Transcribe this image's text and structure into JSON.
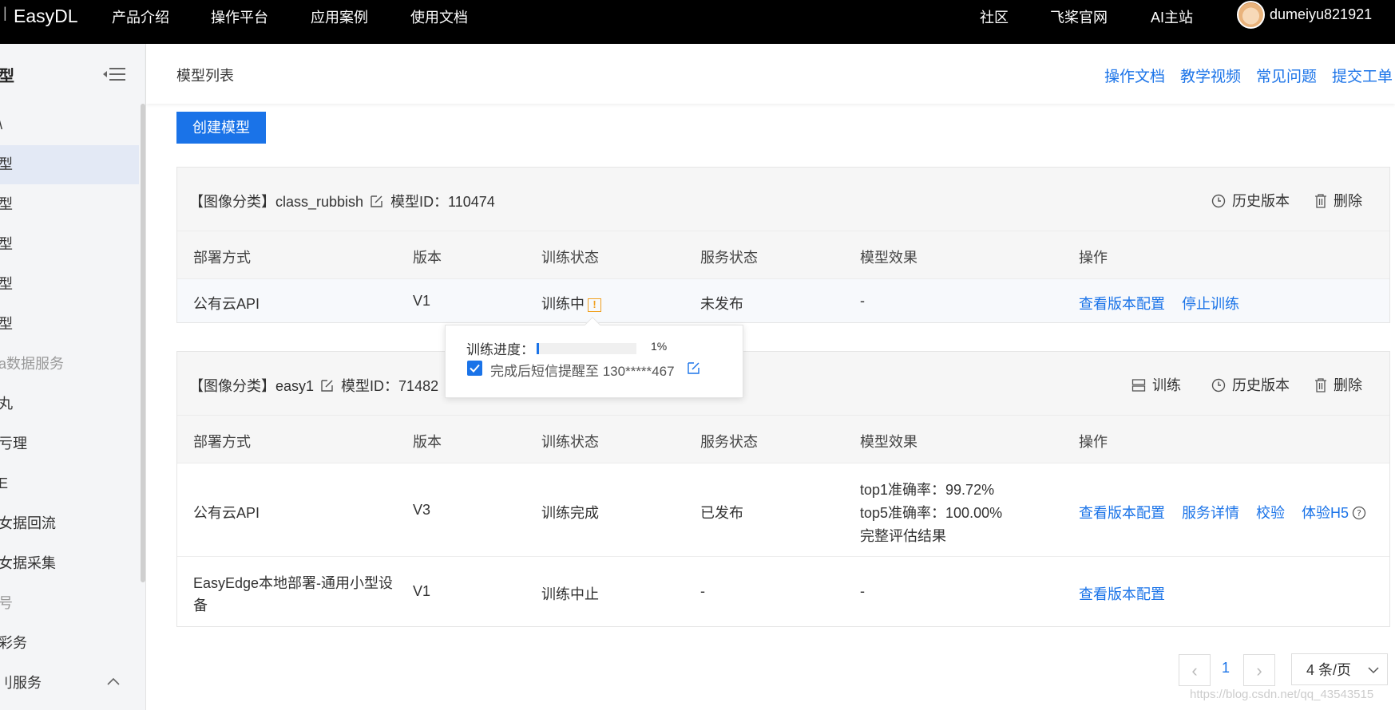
{
  "topbar": {
    "logo": "EasyDL",
    "nav": [
      "产品介绍",
      "操作平台",
      "应用案例",
      "使用文档"
    ],
    "right_nav": [
      "社区",
      "飞桨官网",
      "AI主站"
    ],
    "username": "dumeiyu821921"
  },
  "sidebar": {
    "title": "型",
    "items": [
      {
        "label": "\\",
        "active": false,
        "grey": false
      },
      {
        "label": "型",
        "active": true,
        "grey": false
      },
      {
        "label": "型",
        "active": false,
        "grey": false
      },
      {
        "label": "型",
        "active": false,
        "grey": false
      },
      {
        "label": "型",
        "active": false,
        "grey": false
      },
      {
        "label": "型",
        "active": false,
        "grey": false
      },
      {
        "label": "a数据服务",
        "active": false,
        "grey": true
      },
      {
        "label": "丸",
        "active": false,
        "grey": false
      },
      {
        "label": "亏理",
        "active": false,
        "grey": false
      },
      {
        "label": "E",
        "active": false,
        "grey": false
      },
      {
        "label": "女据回流",
        "active": false,
        "grey": false
      },
      {
        "label": "女据采集",
        "active": false,
        "grey": false
      },
      {
        "label": "号",
        "active": false,
        "grey": true
      },
      {
        "label": "彩务",
        "active": false,
        "grey": false
      },
      {
        "label": "刂服务",
        "active": false,
        "grey": false
      }
    ]
  },
  "header": {
    "page_title": "模型列表",
    "links": [
      "操作文档",
      "教学视频",
      "常见问题",
      "提交工单"
    ]
  },
  "create_button": "创建模型",
  "table_headers": [
    "部署方式",
    "版本",
    "训练状态",
    "服务状态",
    "模型效果",
    "操作"
  ],
  "models": [
    {
      "title": "【图像分类】class_rubbish",
      "model_id": "模型ID：110474",
      "actions": [
        "历史版本",
        "删除"
      ],
      "rows": [
        {
          "deploy": "公有云API",
          "version": "V1",
          "train_status": "训练中",
          "service_status": "未发布",
          "effect": "-",
          "ops": [
            "查看版本配置",
            "停止训练"
          ]
        }
      ]
    },
    {
      "title": "【图像分类】easy1",
      "model_id": "模型ID：71482",
      "actions": [
        "训练",
        "历史版本",
        "删除"
      ],
      "rows": [
        {
          "deploy": "公有云API",
          "version": "V3",
          "train_status": "训练完成",
          "service_status": "已发布",
          "effect_lines": [
            "top1准确率：99.72%",
            "top5准确率：100.00%"
          ],
          "effect_link": "完整评估结果",
          "ops": [
            "查看版本配置",
            "服务详情",
            "校验",
            "体验H5"
          ]
        },
        {
          "deploy_line1": "EasyEdge本地部署-通用小型设",
          "deploy_line2": "备",
          "version": "V1",
          "train_status": "训练中止",
          "service_status": "-",
          "effect": "-",
          "ops": [
            "查看版本配置"
          ]
        }
      ]
    }
  ],
  "popover": {
    "progress_label": "训练进度：",
    "progress_value": "1%",
    "progress_fraction": 0.01,
    "sms_label": "完成后短信提醒至 130*****467"
  },
  "pagination": {
    "current_page": "1",
    "page_size": "4 条/页"
  },
  "watermark": "https://blog.csdn.net/qq_43543515",
  "colors": {
    "accent": "#1a73e8",
    "warning": "#f0a020",
    "topbar": "#000000"
  }
}
